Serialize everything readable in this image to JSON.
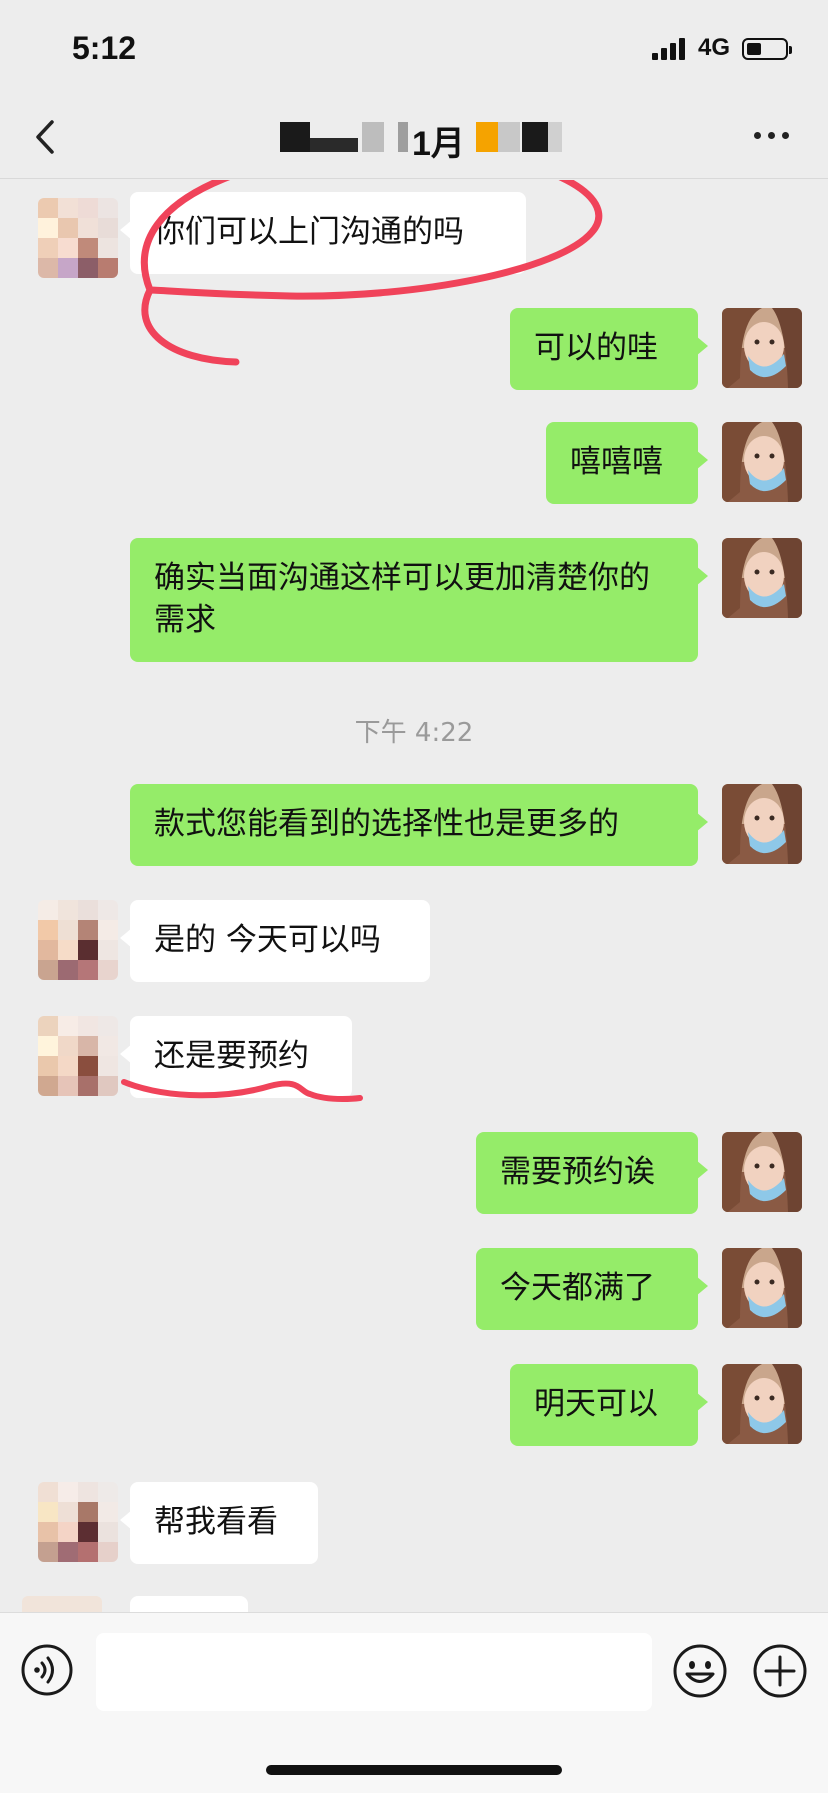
{
  "status_bar": {
    "time": "5:12",
    "network": "4G"
  },
  "header": {
    "title_visible": "1月"
  },
  "messages": [
    {
      "side": "them",
      "text": "你们可以上门沟通的吗"
    },
    {
      "side": "me",
      "text": "可以的哇"
    },
    {
      "side": "me",
      "text": "嘻嘻嘻"
    },
    {
      "side": "me",
      "text": "确实当面沟通这样可以更加清楚你的需求"
    },
    {
      "side": "me",
      "text": "款式您能看到的选择性也是更多的"
    },
    {
      "side": "them",
      "text": "是的 今天可以吗"
    },
    {
      "side": "them",
      "text": "还是要预约"
    },
    {
      "side": "me",
      "text": "需要预约诶"
    },
    {
      "side": "me",
      "text": "今天都满了"
    },
    {
      "side": "me",
      "text": "明天可以"
    },
    {
      "side": "them",
      "text": "帮我看看"
    }
  ],
  "timestamp": "下午 4:22",
  "colors": {
    "my_bubble": "#95ec69",
    "their_bubble": "#ffffff",
    "background": "#ededed",
    "annotation": "#f0435a"
  },
  "icons": [
    "back-arrow-icon",
    "more-dots-icon",
    "voice-icon",
    "emoji-icon",
    "plus-icon"
  ]
}
